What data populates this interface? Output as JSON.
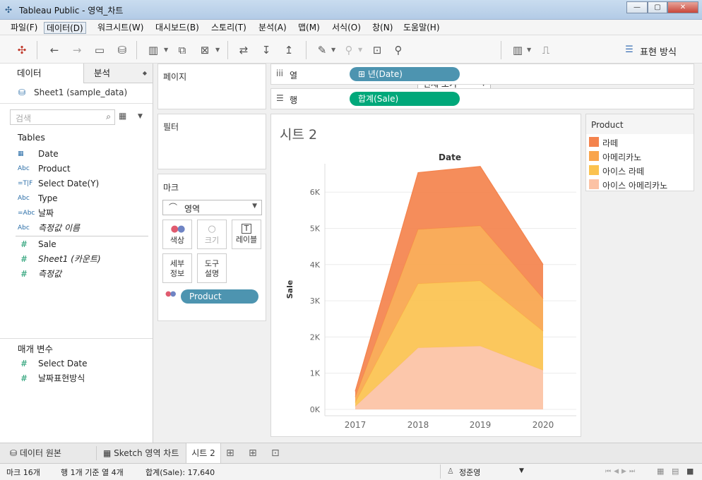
{
  "window": {
    "title": "Tableau Public - 영역_차트",
    "min": "—",
    "max": "▢",
    "close": "✕"
  },
  "menu": [
    "파일(F)",
    "데이터(D)",
    "워크시트(W)",
    "대시보드(B)",
    "스토리(T)",
    "분석(A)",
    "맵(M)",
    "서식(O)",
    "창(N)",
    "도움말(H)"
  ],
  "toolbar": {
    "view_select": "전체 보기",
    "show_me": "표현 방식"
  },
  "datapane": {
    "tab_data": "데이터",
    "tab_analysis": "분석",
    "datasource": "Sheet1 (sample_data)",
    "search_placeholder": "검색",
    "tables_header": "Tables",
    "dimensions": [
      {
        "type": "date",
        "icon": "▦",
        "name": "Date",
        "italic": false
      },
      {
        "type": "abc",
        "icon": "Abc",
        "name": "Product",
        "italic": false
      },
      {
        "type": "calc",
        "icon": "=T|F",
        "name": "Select Date(Y)",
        "italic": false
      },
      {
        "type": "abc",
        "icon": "Abc",
        "name": "Type",
        "italic": false
      },
      {
        "type": "calc-abc",
        "icon": "=Abc",
        "name": "날짜",
        "italic": false
      },
      {
        "type": "abc",
        "icon": "Abc",
        "name": "측정값 이름",
        "italic": true
      }
    ],
    "measures": [
      {
        "name": "Sale",
        "italic": false
      },
      {
        "name": "Sheet1 (카운트)",
        "italic": true
      },
      {
        "name": "측정값",
        "italic": true
      }
    ],
    "params_header": "매개 변수",
    "params": [
      "Select Date",
      "날짜표현방식"
    ]
  },
  "shelves": {
    "pages": "페이지",
    "filters": "필터",
    "marks": "마크",
    "mark_type": "영역",
    "mark_buttons": [
      "색상",
      "크기",
      "레이블",
      "세부\n정보",
      "도구\n설명"
    ],
    "mark_pill": "Product",
    "columns_label": "열",
    "rows_label": "행",
    "columns_pill": "⊞ 년(Date)",
    "rows_pill": "합계(Sale)"
  },
  "legend": {
    "title": "Product",
    "items": [
      {
        "label": "라떼",
        "color": "#f4834d"
      },
      {
        "label": "아메리카노",
        "color": "#f9a54d"
      },
      {
        "label": "아이스 라떼",
        "color": "#fbc24f"
      },
      {
        "label": "아이스 아메리카노",
        "color": "#fcc2a4"
      }
    ]
  },
  "sheet_title": "시트 2",
  "chart_data": {
    "type": "area",
    "title": "Date",
    "xlabel": "",
    "ylabel": "Sale",
    "categories": [
      "2017",
      "2018",
      "2019",
      "2020"
    ],
    "ytick_labels": [
      "0K",
      "1K",
      "2K",
      "3K",
      "4K",
      "5K",
      "6K"
    ],
    "ylim": [
      0,
      6900
    ],
    "stacked": true,
    "series": [
      {
        "name": "아이스 아메리카노",
        "values": [
          80,
          1700,
          1750,
          1080
        ],
        "color": "#fcc2a4"
      },
      {
        "name": "아이스 라떼",
        "values": [
          110,
          1770,
          1800,
          1080
        ],
        "color": "#fbc24f"
      },
      {
        "name": "아메리카노",
        "values": [
          150,
          1500,
          1520,
          900
        ],
        "color": "#f9a54d"
      },
      {
        "name": "라떼",
        "values": [
          160,
          1570,
          1640,
          940
        ],
        "color": "#f4834d"
      }
    ]
  },
  "tabs": {
    "datasource": "데이터 원본",
    "sketch": "Sketch 영역 차트",
    "sheet2": "시트 2"
  },
  "status": {
    "marks": "마크 16개",
    "rowscols": "행 1개 기준 열 4개",
    "sum": "합계(Sale): 17,640",
    "user": "정준영"
  }
}
